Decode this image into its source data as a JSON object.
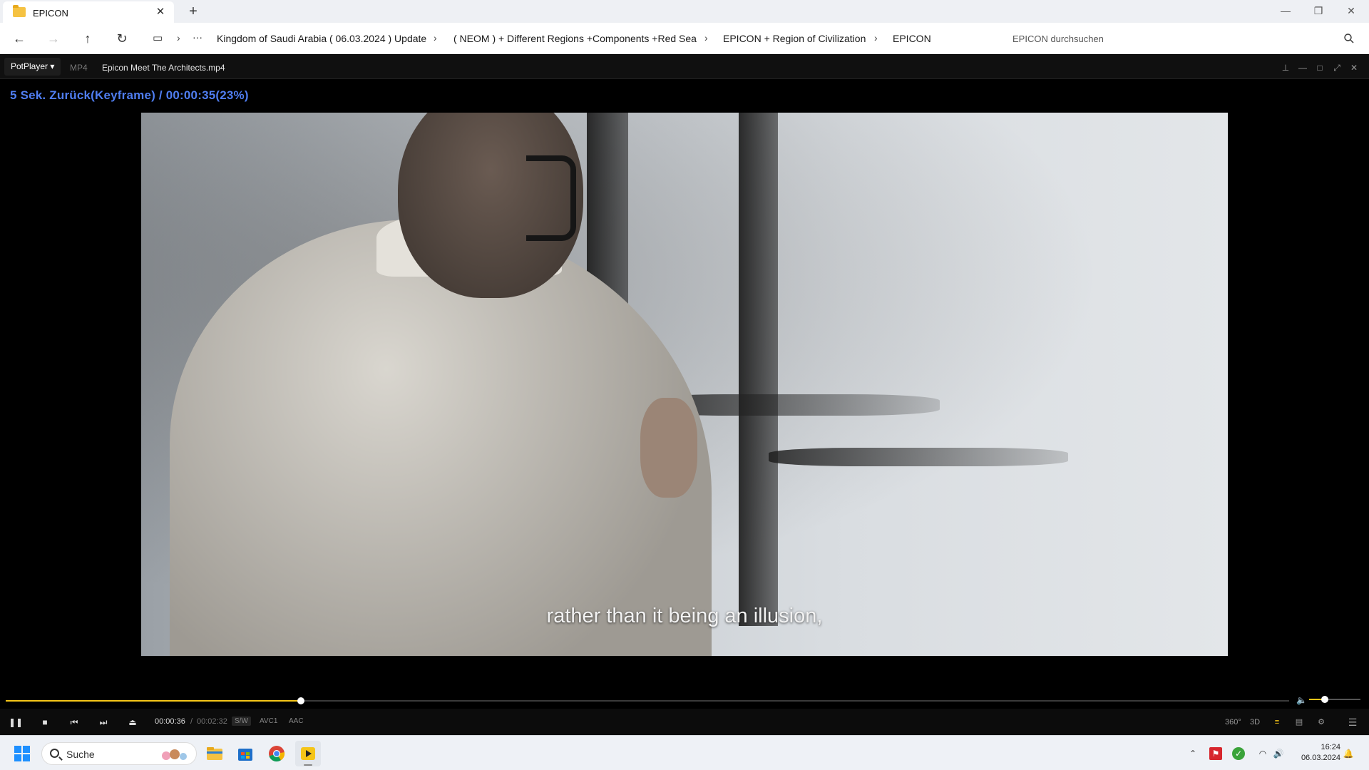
{
  "explorer": {
    "tab_title": "EPICON",
    "new_tab_symbol": "+",
    "close_symbol": "✕",
    "nav": {
      "back_icon": "arrow-left-icon",
      "forward_icon": "arrow-right-icon",
      "up_icon": "arrow-up-icon",
      "refresh_icon": "refresh-icon"
    },
    "breadcrumbs": [
      "Kingdom of Saudi Arabia ( 06.03.2024 ) Update",
      "( NEOM ) + Different Regions +Components +Red Sea",
      "EPICON + Region of Civilization",
      "EPICON"
    ],
    "ellipsis": "···",
    "search_placeholder": "EPICON durchsuchen"
  },
  "player": {
    "app_name": "PotPlayer",
    "format": "MP4",
    "file_name": "Epicon  Meet The Architects.mp4",
    "osd_text": "5  Sek. Zurück(Keyframe) / 00:00:35(23%)",
    "subtitle": "rather than it being an illusion,",
    "current_time": "00:00:36",
    "time_separator": "/",
    "total_time": "00:02:32",
    "chips": {
      "sw": "S/W",
      "video_codec": "AVC1",
      "audio_codec": "AAC"
    },
    "progress_fraction": 0.23,
    "volume_fraction": 0.3,
    "right_controls": {
      "vr": "360°",
      "stereo": "3D"
    },
    "accent_color": "#f5c518",
    "osd_color": "#4f7df0"
  },
  "taskbar": {
    "search_label": "Suche",
    "time": "16:24",
    "date": "06.03.2024",
    "apps": [
      "file-explorer-icon",
      "microsoft-store-icon",
      "chrome-icon",
      "potplayer-icon"
    ]
  }
}
